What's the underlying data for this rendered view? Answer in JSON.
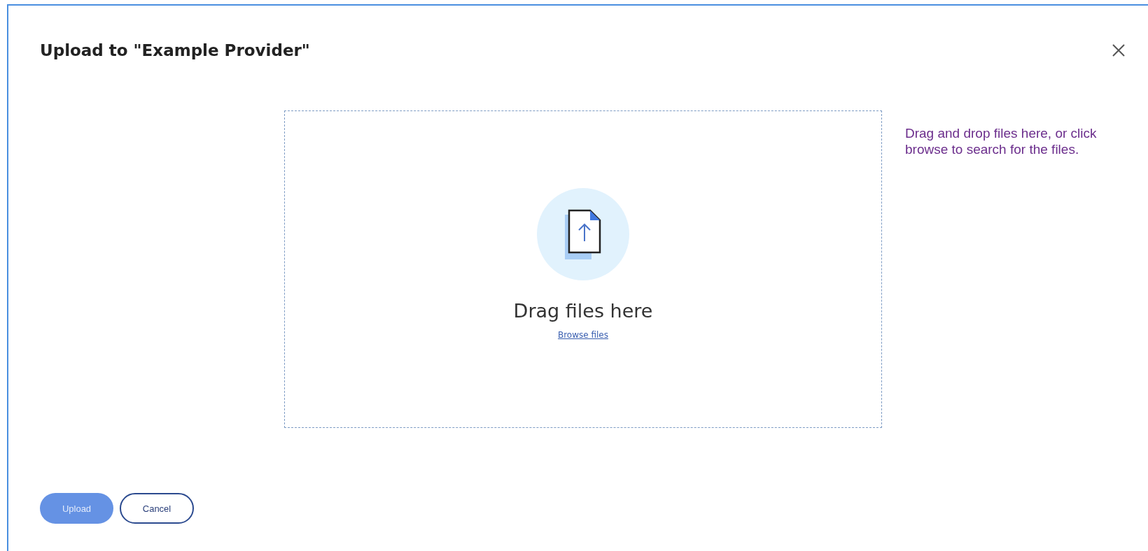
{
  "dialog": {
    "title": "Upload to \"Example Provider\""
  },
  "dropzone": {
    "heading": "Drag files here",
    "link": "Browse files"
  },
  "help_text": "Drag and drop files here, or click browse to search for the files.",
  "buttons": [
    {
      "label": "Upload",
      "kind": "primary",
      "disabled": true
    },
    {
      "label": "Cancel",
      "kind": "secondary",
      "disabled": false
    }
  ]
}
